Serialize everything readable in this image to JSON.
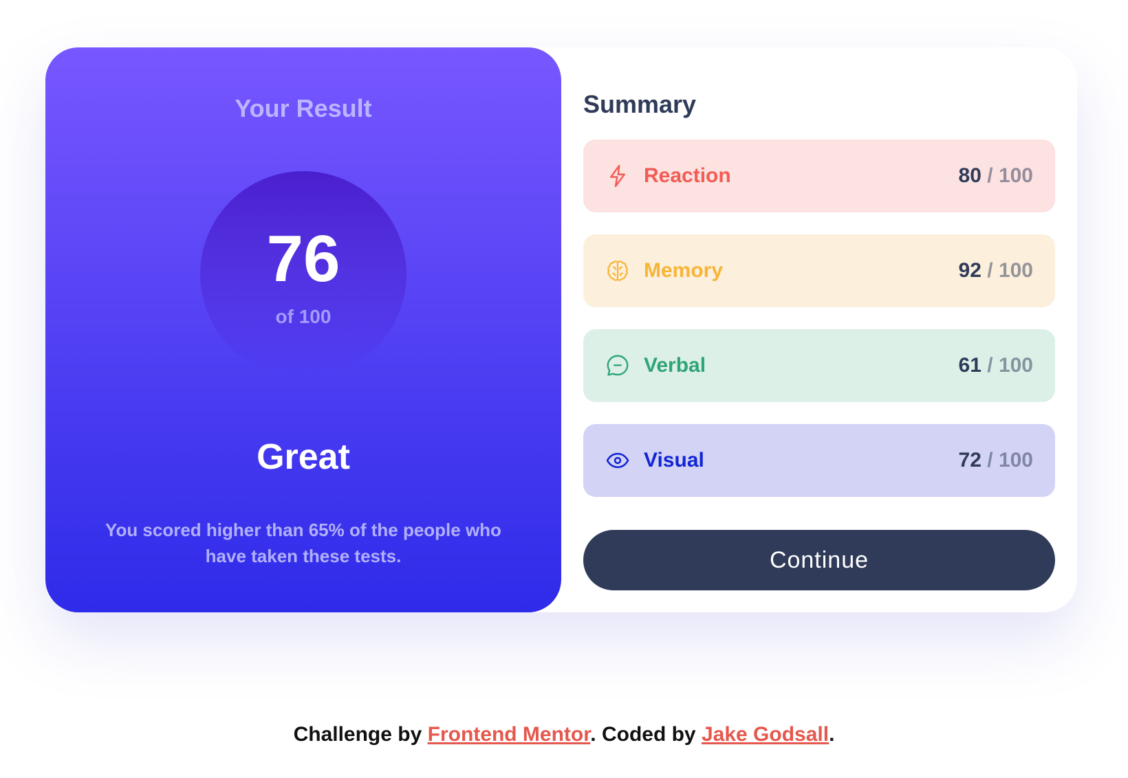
{
  "result": {
    "title": "Your Result",
    "score": "76",
    "score_of": "of 100",
    "rating": "Great",
    "description": "You scored higher than 65% of the people who have taken these tests."
  },
  "summary": {
    "title": "Summary",
    "items": [
      {
        "label": "Reaction",
        "score": "80",
        "separator": "/",
        "max": "100",
        "icon": "lightning-icon",
        "color": "#f25c54"
      },
      {
        "label": "Memory",
        "score": "92",
        "separator": "/",
        "max": "100",
        "icon": "brain-icon",
        "color": "#f7b538"
      },
      {
        "label": "Verbal",
        "score": "61",
        "separator": "/",
        "max": "100",
        "icon": "chat-bubble-icon",
        "color": "#2fa577"
      },
      {
        "label": "Visual",
        "score": "72",
        "separator": "/",
        "max": "100",
        "icon": "eye-icon",
        "color": "#1125d4"
      }
    ],
    "continue_label": "Continue"
  },
  "attribution": {
    "prefix": "Challenge by ",
    "link1": "Frontend Mentor",
    "middle": ". Coded by ",
    "link2": "Jake Godsall",
    "suffix": "."
  },
  "colors": {
    "gradient_start": "#7857ff",
    "gradient_end": "#2e2be9",
    "dark_navy": "#303b59",
    "link": "#e5584d"
  }
}
